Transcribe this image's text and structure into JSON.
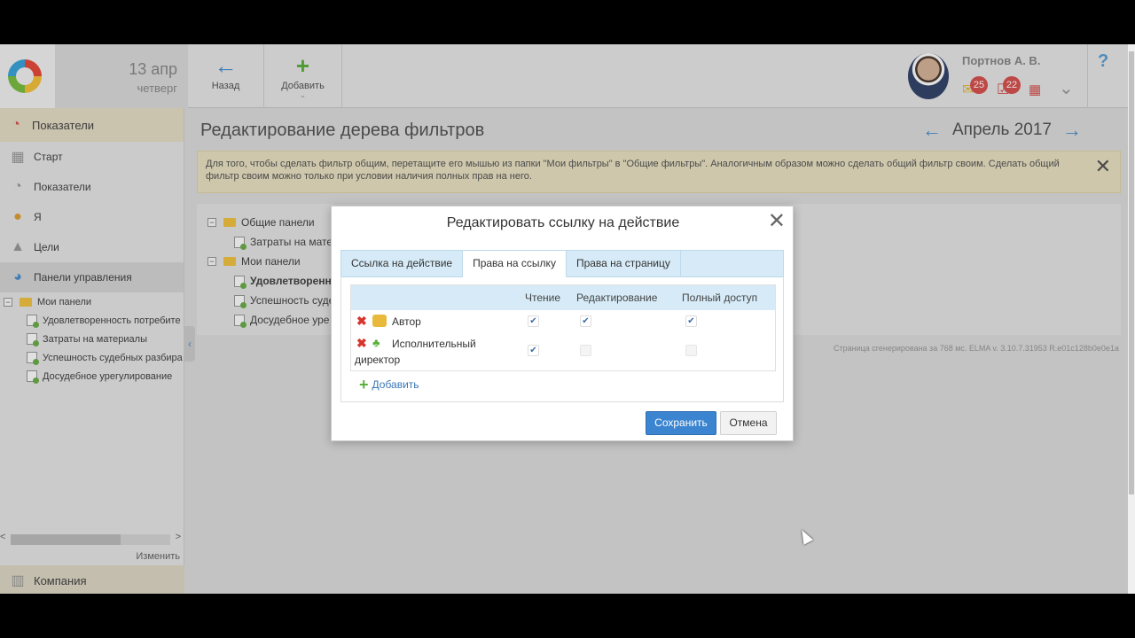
{
  "header": {
    "date_day": "13 апр",
    "date_weekday": "четверг",
    "back_label": "Назад",
    "add_label": "Добавить",
    "user_name": "Портнов А. В.",
    "badge_messages": "25",
    "badge_tasks": "22",
    "help": "?"
  },
  "sidebar": {
    "section_title": "Показатели",
    "items": [
      {
        "label": "Старт"
      },
      {
        "label": "Показатели"
      },
      {
        "label": "Я"
      },
      {
        "label": "Цели"
      },
      {
        "label": "Панели управления"
      }
    ],
    "tree_root": "Мои панели",
    "tree_items": [
      "Удовлетворенность потребите",
      "Затраты на материалы",
      "Успешность судебных разбира",
      "Досудебное урегулирование"
    ],
    "edit_label": "Изменить",
    "company_label": "Компания"
  },
  "main": {
    "page_title": "Редактирование дерева фильтров",
    "month_label": "Апрель 2017",
    "notice_text": "Для того, чтобы сделать фильтр общим, перетащите его мышью из папки \"Мои фильтры\" в \"Общие фильтры\". Аналогичным образом можно сделать общий фильтр своим. Сделать общий фильтр своим можно только при условии наличия полных прав на него.",
    "tree": {
      "group1": "Общие панели",
      "group1_items": [
        "Затраты на мате"
      ],
      "group2": "Мои панели",
      "group2_items": [
        "Удовлетворенно",
        "Успешность суде",
        "Досудебное уре"
      ]
    },
    "footer_note": "Страница сгенерирована за 768 мс. ELMA v. 3.10.7.31953 R.e01c128b0e0e1a"
  },
  "modal": {
    "title": "Редактировать ссылку на действие",
    "tabs": [
      {
        "label": "Ссылка на действие",
        "active": false
      },
      {
        "label": "Права на ссылку",
        "active": true
      },
      {
        "label": "Права на страницу",
        "active": false
      }
    ],
    "columns": [
      "Чтение",
      "Редактирование",
      "Полный доступ"
    ],
    "rows": [
      {
        "name": "Автор",
        "read": true,
        "edit": true,
        "full": true
      },
      {
        "name_line1": "Исполнительный",
        "name_line2": "директор",
        "read": true,
        "edit": false,
        "full": false
      }
    ],
    "add_label": "Добавить",
    "save_label": "Сохранить",
    "cancel_label": "Отмена"
  },
  "colors": {
    "accent": "#3a84d0",
    "remove": "#d9342b",
    "tab_bg": "#d6ebf7"
  }
}
